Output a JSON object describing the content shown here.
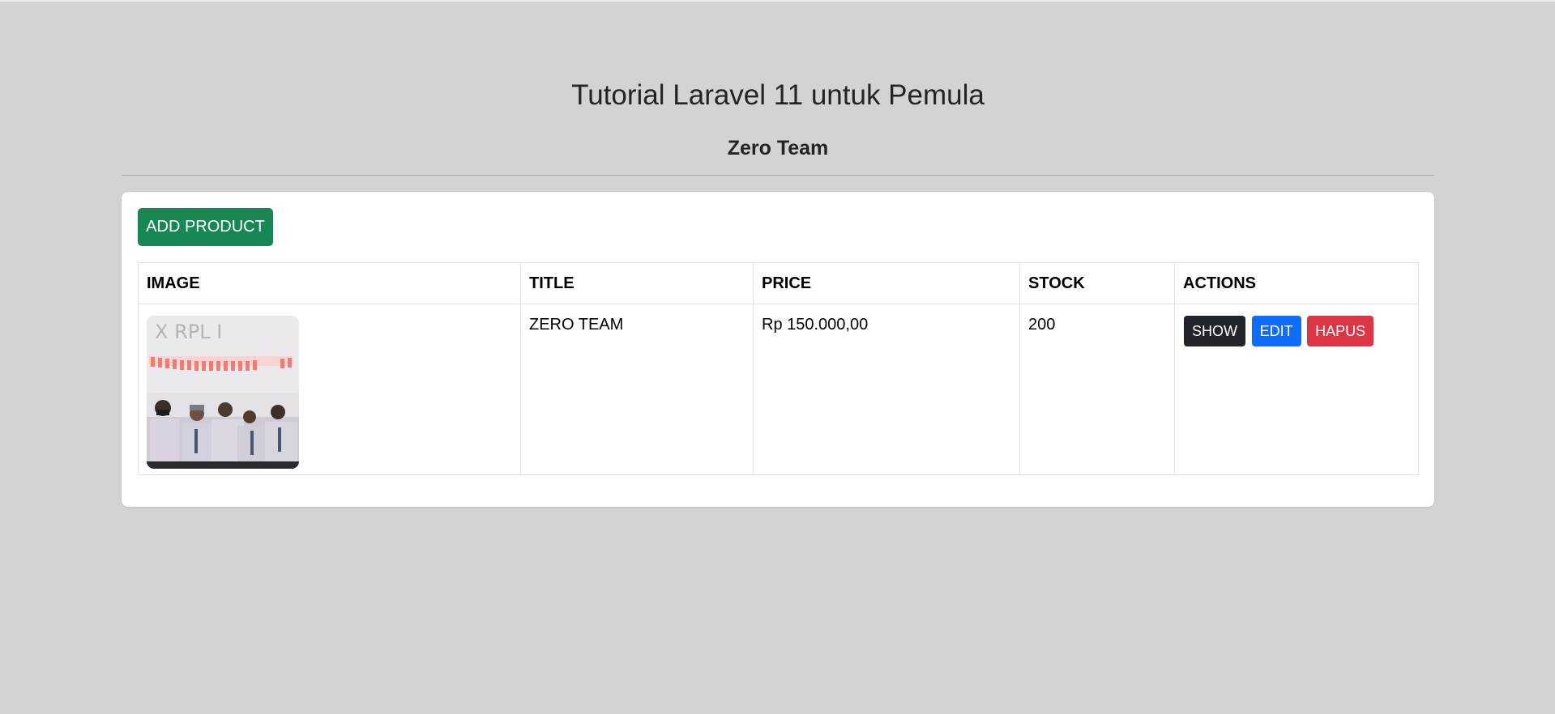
{
  "header": {
    "title": "Tutorial Laravel 11 untuk Pemula",
    "subtitle": "Zero Team"
  },
  "toolbar": {
    "add_label": "ADD PRODUCT"
  },
  "table": {
    "columns": [
      "IMAGE",
      "TITLE",
      "PRICE",
      "STOCK",
      "ACTIONS"
    ],
    "rows": [
      {
        "title": "ZERO TEAM",
        "price": "Rp 150.000,00",
        "stock": "200",
        "actions": {
          "show_label": "SHOW",
          "edit_label": "EDIT",
          "delete_label": "HAPUS"
        }
      }
    ]
  },
  "colors": {
    "background": "#d3d3d3",
    "success": "#198754",
    "dark": "#212529",
    "primary": "#0d6efd",
    "danger": "#dc3545"
  }
}
